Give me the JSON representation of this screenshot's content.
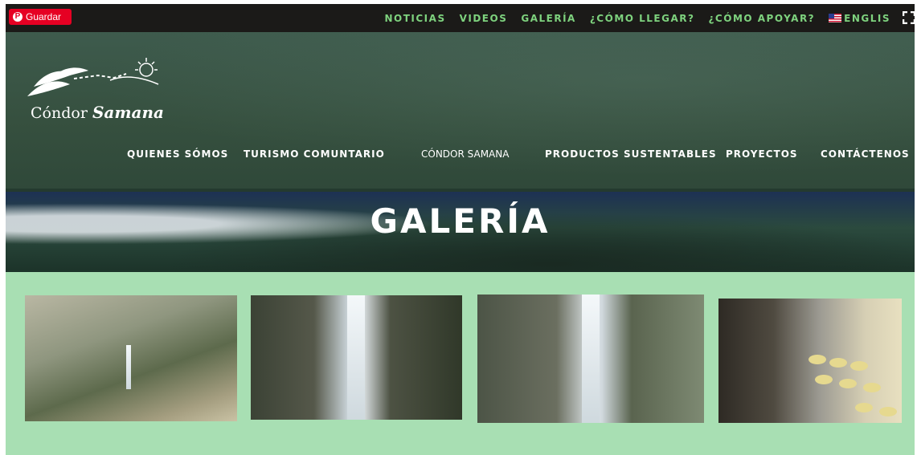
{
  "pinterest": {
    "save_label": "Guardar",
    "icon": "pinterest-icon",
    "color": "#e60023"
  },
  "topnav": {
    "items": [
      "NOTICIAS",
      "VIDEOS",
      "GALERÍA",
      "¿CÓMO LLEGAR?",
      "¿CÓMO APOYAR?"
    ],
    "language_label": "ENGLIS",
    "language_icon": "us-flag-icon",
    "link_color": "#7ed27e"
  },
  "logo": {
    "text_plain": "Cóndor",
    "text_script": "Samana"
  },
  "mainnav": {
    "items": [
      "QUIENES SÓMOS",
      "TURISMO COMUNTARIO",
      "CÓNDOR SAMANA",
      "PRODUCTOS SUSTENTABLES",
      "PROYECTOS",
      "CONTÁCTENOS"
    ]
  },
  "banner": {
    "title": "GALERÍA"
  },
  "gallery": {
    "background": "#a8dfb3",
    "images": [
      "valley-waterfall-photo",
      "waterfall-cliff-photo",
      "waterfall-visitors-photo",
      "cheese-room-photo"
    ]
  }
}
